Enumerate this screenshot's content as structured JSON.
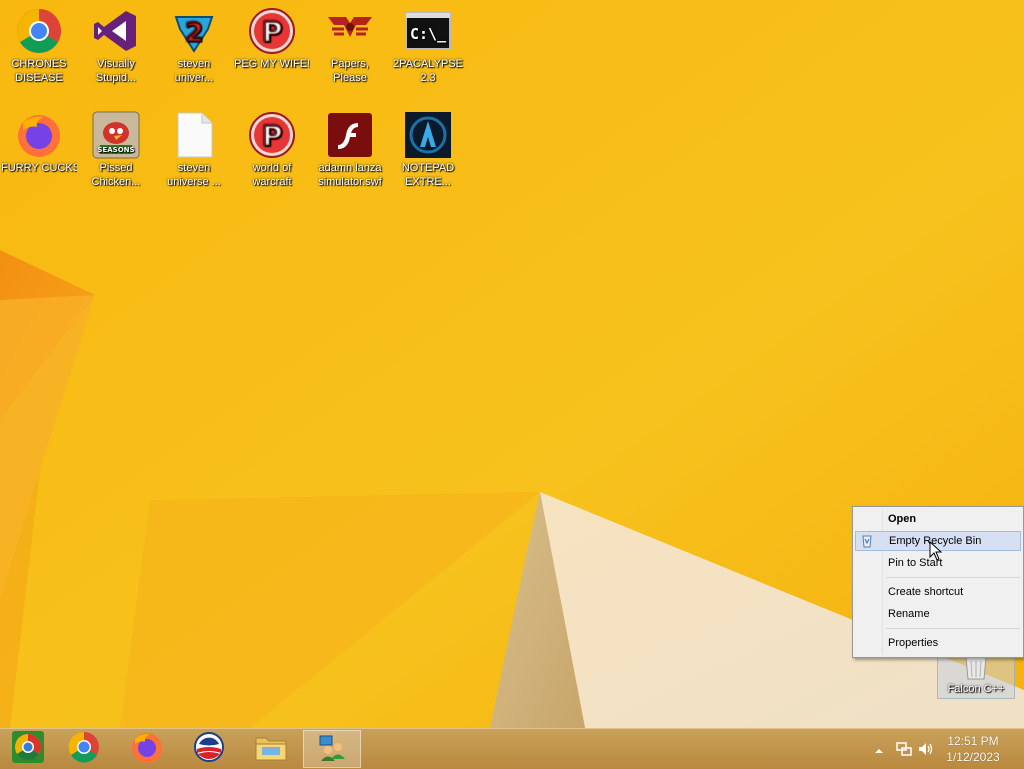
{
  "desktop": {
    "icons": [
      {
        "name": "CHRONES DISEASE",
        "line1": "CHRONES",
        "line2": "DISEASE",
        "icon": "chrome-icon"
      },
      {
        "name": "Visually Stupid...",
        "line1": "Visually",
        "line2": "Stupid...",
        "icon": "visual-studio-icon"
      },
      {
        "name": "steven univer...",
        "line1": "steven",
        "line2": "univer...",
        "icon": "steven-universe-icon"
      },
      {
        "name": "PEG MY WIFE!",
        "line1": "PEG MY WIFE!",
        "line2": "",
        "icon": "pegasus-icon"
      },
      {
        "name": "Papers, Please",
        "line1": "Papers,",
        "line2": "Please",
        "icon": "papers-please-icon"
      },
      {
        "name": "2PACALYPSE 2.3",
        "line1": "2PACALYPSE",
        "line2": "2.3",
        "icon": "command-prompt-icon"
      },
      {
        "name": "FURRY CUCKS",
        "line1": "FURRY CUCKS",
        "line2": "",
        "icon": "firefox-icon"
      },
      {
        "name": "Pissed Chicken...",
        "line1": "Pissed",
        "line2": "Chicken...",
        "icon": "angry-birds-icon"
      },
      {
        "name": "steven universe ...",
        "line1": "steven",
        "line2": "universe ...",
        "icon": "blank-file-icon"
      },
      {
        "name": "world of warcraft",
        "line1": "world of",
        "line2": "warcraft",
        "icon": "pegasus-icon"
      },
      {
        "name": "adamn lanza simulator.swf",
        "line1": "adamn lanza",
        "line2": "simulator.swf",
        "icon": "flash-icon"
      },
      {
        "name": "NOTEPAD EXTRE...",
        "line1": "NOTEPAD",
        "line2": "EXTRE...",
        "icon": "notepad-extreme-icon"
      }
    ],
    "recycle_bin": {
      "label": "Falcon C++",
      "icon": "recycle-bin-icon"
    }
  },
  "context_menu": {
    "items": [
      {
        "label": "Open",
        "bold": true
      },
      {
        "label": "Empty Recycle Bin",
        "highlighted": true,
        "icon": "recycle-bin-small-icon"
      },
      {
        "label": "Pin to Start"
      },
      {
        "separator": true
      },
      {
        "label": "Create shortcut"
      },
      {
        "label": "Rename"
      },
      {
        "separator": true
      },
      {
        "label": "Properties"
      }
    ]
  },
  "taskbar": {
    "buttons": [
      {
        "icon": "chrome-canary-icon"
      },
      {
        "icon": "chrome-icon"
      },
      {
        "icon": "firefox-icon"
      },
      {
        "icon": "obama-logo-icon"
      },
      {
        "icon": "file-explorer-icon"
      },
      {
        "icon": "network-people-icon",
        "active": true
      }
    ],
    "clock": {
      "time": "12:51 PM",
      "date": "1/12/2023"
    }
  },
  "colors": {
    "wallpaper": "#f6b40e",
    "menu_highlight": "#d5e1f2",
    "taskbar": "#c09550"
  }
}
